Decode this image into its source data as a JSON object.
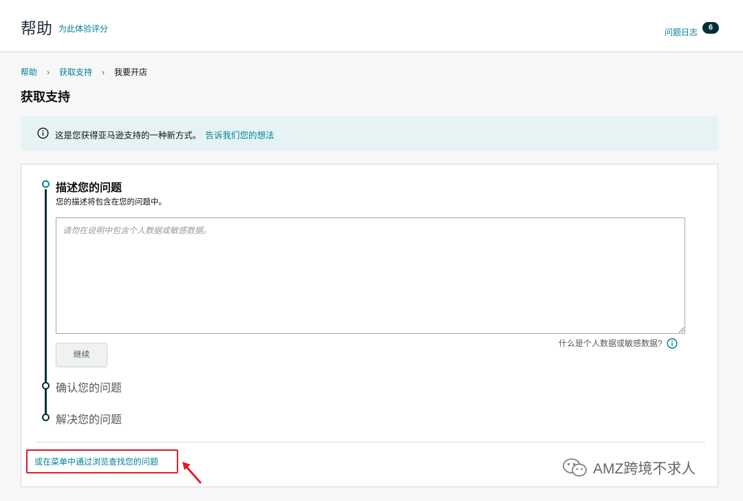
{
  "header": {
    "title": "帮助",
    "rate_link": "为此体验评分",
    "log_link": "问题日志",
    "log_count": "6"
  },
  "breadcrumb": {
    "items": [
      "帮助",
      "获取支持",
      "我要开店"
    ]
  },
  "page_title": "获取支持",
  "info_banner": {
    "text": "这是您获得亚马逊支持的一种新方式。",
    "link": "告诉我们您的想法"
  },
  "steps": {
    "step1": {
      "title": "描述您的问题",
      "subtitle": "您的描述将包含在您的问题中。",
      "textarea_placeholder": "请勿在说明中包含个人数据或敏感数据。",
      "textarea_value": "",
      "privacy_hint": "什么是个人数据或敏感数据?",
      "continue_button": "继续"
    },
    "step2": {
      "title": "确认您的问题"
    },
    "step3": {
      "title": "解决您的问题"
    }
  },
  "browse_link": "或在菜单中通过浏览查找您的问题",
  "watermark": "AMZ跨境不求人",
  "colors": {
    "accent": "#008296",
    "dark": "#002f36",
    "banner_bg": "#e6f3f5",
    "highlight_red": "#e31b23"
  }
}
